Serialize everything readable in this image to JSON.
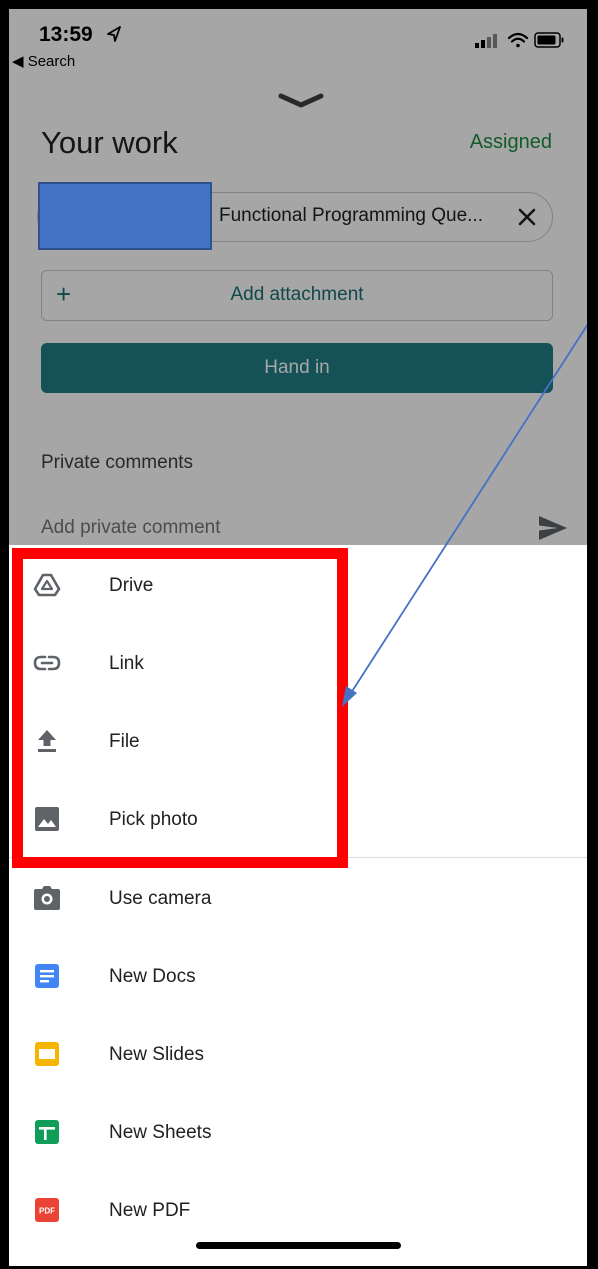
{
  "status_bar": {
    "time": "13:59",
    "back_label": "◀ Search"
  },
  "header": {
    "title": "Your work",
    "status": "Assigned"
  },
  "attachment": {
    "name": "Functional Programming Que..."
  },
  "add_attachment": {
    "plus": "+",
    "label": "Add attachment"
  },
  "hand_in": {
    "label": "Hand in"
  },
  "comments": {
    "heading": "Private comments",
    "placeholder": "Add private comment"
  },
  "menu": {
    "items": [
      {
        "label": "Drive",
        "icon": "drive-icon"
      },
      {
        "label": "Link",
        "icon": "link-icon"
      },
      {
        "label": "File",
        "icon": "upload-icon"
      },
      {
        "label": "Pick photo",
        "icon": "photo-icon"
      },
      {
        "label": "Use camera",
        "icon": "camera-icon"
      },
      {
        "label": "New Docs",
        "icon": "docs-icon"
      },
      {
        "label": "New Slides",
        "icon": "slides-icon"
      },
      {
        "label": "New Sheets",
        "icon": "sheets-icon"
      },
      {
        "label": "New PDF",
        "icon": "pdf-icon"
      }
    ]
  },
  "colors": {
    "accent": "#1f7f86",
    "assigned": "#1e8e3e",
    "docs": "#4285f4",
    "slides": "#f4b400",
    "sheets": "#0f9d58",
    "pdf": "#ea4335",
    "annotation": "#ff0000"
  }
}
